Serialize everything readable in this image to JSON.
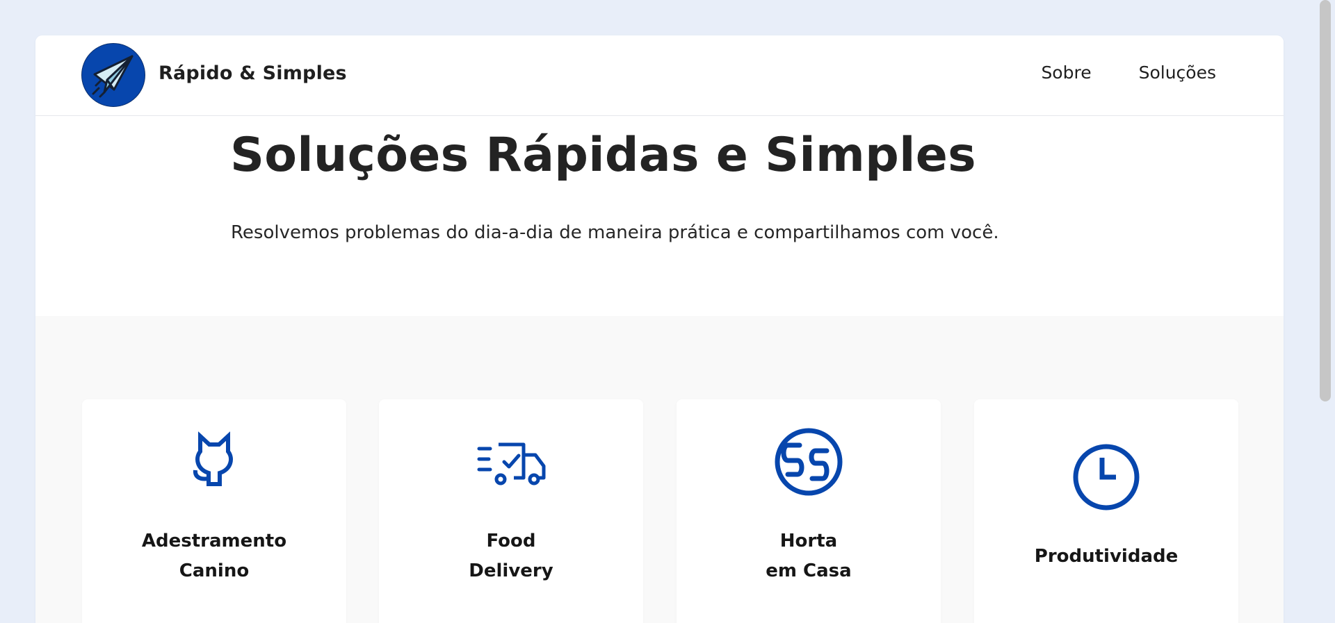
{
  "header": {
    "brand_name": "Rápido & Simples",
    "logo_icon": "paper-plane-icon",
    "nav": [
      {
        "label": "Sobre"
      },
      {
        "label": "Soluções"
      }
    ]
  },
  "hero": {
    "title": "Soluções Rápidas e Simples",
    "subtitle": "Resolvemos problemas do dia-a-dia de maneira prática e compartilhamos com você."
  },
  "solutions": [
    {
      "icon": "cat-icon",
      "line1": "Adestramento",
      "line2": "Canino"
    },
    {
      "icon": "delivery-truck-icon",
      "line1": "Food",
      "line2": "Delivery"
    },
    {
      "icon": "globe-icon",
      "line1": "Horta",
      "line2": "em Casa"
    },
    {
      "icon": "clock-icon",
      "line1": "Produtividade",
      "line2": ""
    }
  ],
  "colors": {
    "brand_blue": "#0746ad",
    "page_background": "#e8eef9",
    "section_background": "#f9f9f9",
    "text": "#222222"
  }
}
